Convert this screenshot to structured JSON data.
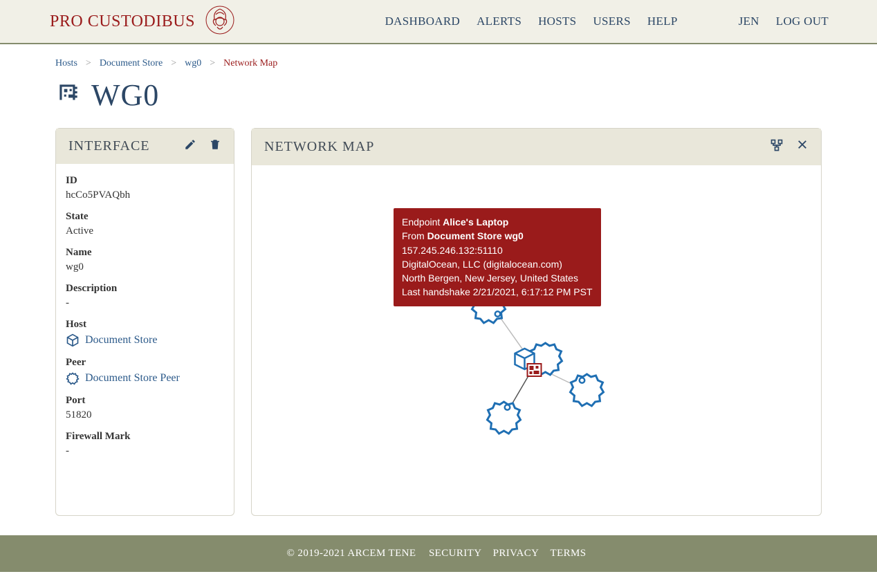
{
  "brand": "PRO CUSTODIBUS",
  "nav": {
    "dashboard": "DASHBOARD",
    "alerts": "ALERTS",
    "hosts": "HOSTS",
    "users": "USERS",
    "help": "HELP",
    "user": "JEN",
    "logout": "LOG OUT"
  },
  "breadcrumb": {
    "hosts": "Hosts",
    "doc": "Document Store",
    "wg0": "wg0",
    "map": "Network Map"
  },
  "page_title": "WG0",
  "interface": {
    "title": "INTERFACE",
    "id_label": "ID",
    "id": "hcCo5PVAQbh",
    "state_label": "State",
    "state": "Active",
    "name_label": "Name",
    "name": "wg0",
    "desc_label": "Description",
    "desc": "-",
    "host_label": "Host",
    "host": "Document Store",
    "peer_label": "Peer",
    "peer": "Document Store Peer",
    "port_label": "Port",
    "port": "51820",
    "fw_label": "Firewall Mark",
    "fw": "-"
  },
  "map": {
    "title": "NETWORK MAP"
  },
  "tooltip": {
    "line1a": "Endpoint ",
    "line1b": "Alice's Laptop",
    "line2a": "From ",
    "line2b": "Document Store wg0",
    "line3": "157.245.246.132:51110",
    "line4": "DigitalOcean, LLC (digitalocean.com)",
    "line5": "North Bergen, New Jersey, United States",
    "line6": "Last handshake 2/21/2021, 6:17:12 PM PST"
  },
  "footer": {
    "copyright": "© 2019-2021 ARCEM TENE",
    "security": "SECURITY",
    "privacy": "PRIVACY",
    "terms": "TERMS"
  }
}
